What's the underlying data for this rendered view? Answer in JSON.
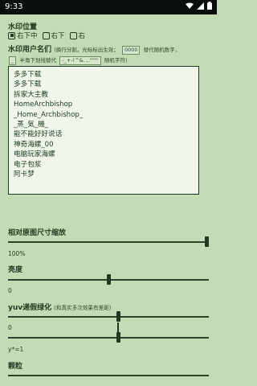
{
  "status_bar": {
    "time": "9:33"
  },
  "watermark_position": {
    "title": "水印位置",
    "options": [
      {
        "label": "右下中",
        "checked": true
      },
      {
        "label": "右下",
        "checked": false
      },
      {
        "label": "右",
        "checked": false
      }
    ]
  },
  "watermark_names": {
    "title": "水印用户名们",
    "hint_1": "(换行分割，光标标出生效；",
    "hint_chip_1": "0000",
    "hint_2": "替代随机数字，",
    "hint_chip_2": "_",
    "hint_3": "半角下划线替代",
    "hint_chip_3": "-_+-!^&. ,.\"\"\"'",
    "hint_4": "随机字符)",
    "lines": [
      "多多下载",
      "多多下载",
      "拆家大主教",
      "HomeArchbishop",
      "_Home_Archbishop_",
      "_蒸_気_機_",
      "能不能好好说话",
      "神奇海螺_00",
      "电脑玩家海螺",
      "电子包浆",
      "阿卡梦"
    ]
  },
  "scale_slider": {
    "title": "相对原图尺寸缩放",
    "value": "100%",
    "fraction": 1.0
  },
  "brightness_slider": {
    "title": "亮度",
    "value": "0",
    "fraction": 0.5
  },
  "yuv_slider": {
    "title": "yuv递假绿化",
    "note": "(和真实多次效果有差距)",
    "value": "0",
    "fraction": 0.55
  },
  "gamma_slider": {
    "value": "y*=1",
    "fraction": 0.55
  },
  "grain_slider": {
    "title": "颗粒"
  }
}
